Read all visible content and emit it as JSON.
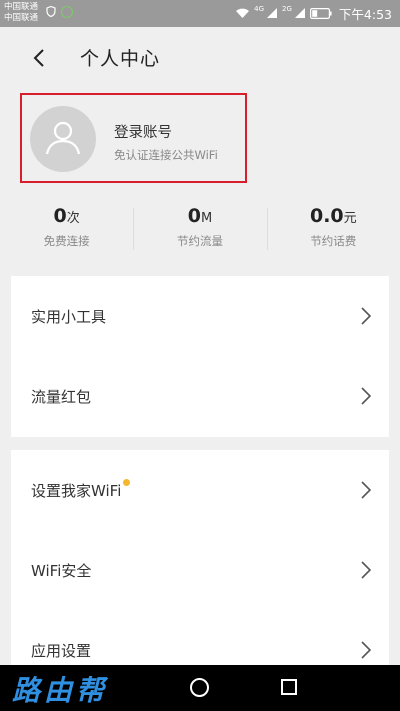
{
  "status_bar": {
    "carrier1": "中国联通",
    "carrier2": "中国联通",
    "net_label_1": "4G",
    "net_label_2": "2G",
    "time": "下午4:53",
    "icons": [
      "shield-icon",
      "status-dot-icon",
      "wifi-icon",
      "signal-icon",
      "signal-icon",
      "battery-icon"
    ]
  },
  "header": {
    "back_icon": "back-arrow-icon",
    "title": "个人中心"
  },
  "profile": {
    "avatar_icon": "user-avatar-icon",
    "login_label": "登录账号",
    "subtitle": "免认证连接公共WiFi",
    "highlight_color": "#d81e2c"
  },
  "stats": [
    {
      "value": "0",
      "unit": "次",
      "label": "免费连接"
    },
    {
      "value": "0",
      "unit": "M",
      "label": "节约流量"
    },
    {
      "value": "0.0",
      "unit": "元",
      "label": "节约话费"
    }
  ],
  "menu_group1": [
    {
      "label": "实用小工具"
    },
    {
      "label": "流量红包"
    }
  ],
  "menu_group2": [
    {
      "label": "设置我家WiFi",
      "badge_color": "#f5b630"
    },
    {
      "label": "WiFi安全"
    },
    {
      "label": "应用设置"
    }
  ],
  "nav_bar": {
    "watermark": "路由帮",
    "icons": [
      "home-circle-icon",
      "recent-apps-icon"
    ]
  }
}
